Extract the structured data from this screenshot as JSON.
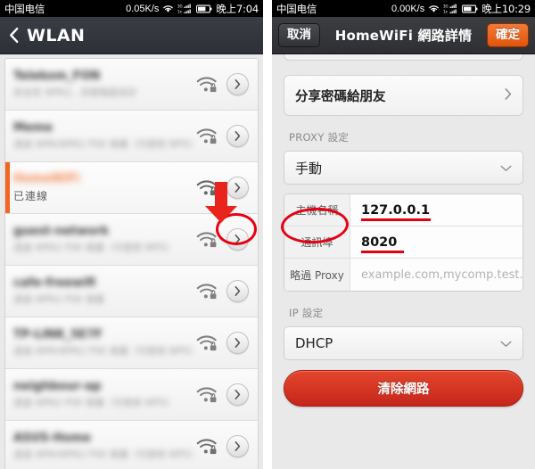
{
  "left": {
    "status": {
      "carrier": "中国电信",
      "speed": "0.05K/s",
      "time": "晚上7:04",
      "wifi_icon": "wifi-icon",
      "signal_icon": "dual-sim-signal-icon",
      "battery_icon": "battery-icon"
    },
    "nav": {
      "back_icon": "back-chevron-icon",
      "title": "WLAN"
    },
    "rows": [
      {
        "ssid": "Telekom_FON",
        "sub": "安全性 WPA2，訊號強度良好",
        "status": "",
        "connected": false,
        "lock": true,
        "bars": 3
      },
      {
        "ssid": "Meme",
        "sub": "透過 WPA/WPA2 PSK 保護（可使用 WPS）",
        "status": "",
        "connected": false,
        "lock": true,
        "bars": 3
      },
      {
        "ssid": "HomeWiFi",
        "sub": "",
        "status": "已連線",
        "connected": true,
        "lock": true,
        "bars": 3
      },
      {
        "ssid": "guest-network",
        "sub": "透過 WPA2 PSK 保護（可使用 WPS）",
        "status": "",
        "connected": false,
        "lock": true,
        "bars": 3
      },
      {
        "ssid": "cafe-freewifi",
        "sub": "透過 WPA2 PSK 保護",
        "status": "",
        "connected": false,
        "lock": true,
        "bars": 3
      },
      {
        "ssid": "TP-LINK_5E7F",
        "sub": "透過 WPA/WPA2 PSK 保護（可使用 WPS）",
        "status": "",
        "connected": false,
        "lock": true,
        "bars": 3
      },
      {
        "ssid": "neighbour-ap",
        "sub": "透過 WPA2 PSK 保護（可使用 WPS）",
        "status": "",
        "connected": false,
        "lock": true,
        "bars": 3
      },
      {
        "ssid": "ASUS-Home",
        "sub": "透過 WPA/WPA2 PSK 保護（可使用 WPS）",
        "status": "",
        "connected": false,
        "lock": true,
        "bars": 3
      }
    ],
    "annotations": {
      "arrow_icon": "red-down-arrow-annotation",
      "ellipse_icon": "red-ellipse-annotation"
    }
  },
  "right": {
    "status": {
      "carrier": "中国电信",
      "speed": "0.00K/s",
      "time": "晚上10:29",
      "wifi_icon": "wifi-icon",
      "signal_icon": "dual-sim-signal-icon",
      "battery_icon": "battery-icon"
    },
    "nav": {
      "cancel_label": "取消",
      "title": "HomeWiFi 網路詳情",
      "confirm_label": "確定"
    },
    "share": {
      "label": "分享密碼給朋友",
      "chevron_icon": "chevron-right-icon"
    },
    "proxy": {
      "section_label": "PROXY 設定",
      "selected": "手動",
      "caret_icon": "chevron-down-icon",
      "fields": [
        {
          "label": "主機名稱",
          "value": "127.0.0.1",
          "placeholder": "",
          "underlined": true,
          "underline_width": 78
        },
        {
          "label": "通訊埠",
          "value": "8020",
          "placeholder": "",
          "underlined": true,
          "underline_width": 48
        },
        {
          "label": "略過 Proxy",
          "value": "",
          "placeholder": "example.com,mycomp.test.",
          "underlined": false,
          "underline_width": 0
        }
      ]
    },
    "ip": {
      "section_label": "IP 設定",
      "selected": "DHCP",
      "caret_icon": "chevron-down-icon"
    },
    "clear_button": {
      "label": "清除網路",
      "color": "#cf3220"
    },
    "annotations": {
      "ellipse_icon": "red-ellipse-annotation"
    }
  },
  "colors": {
    "accent_orange": "#f26522",
    "annotation_red": "#e60012",
    "nav_dark": "#343640",
    "page_bg": "#e9e9e9"
  }
}
